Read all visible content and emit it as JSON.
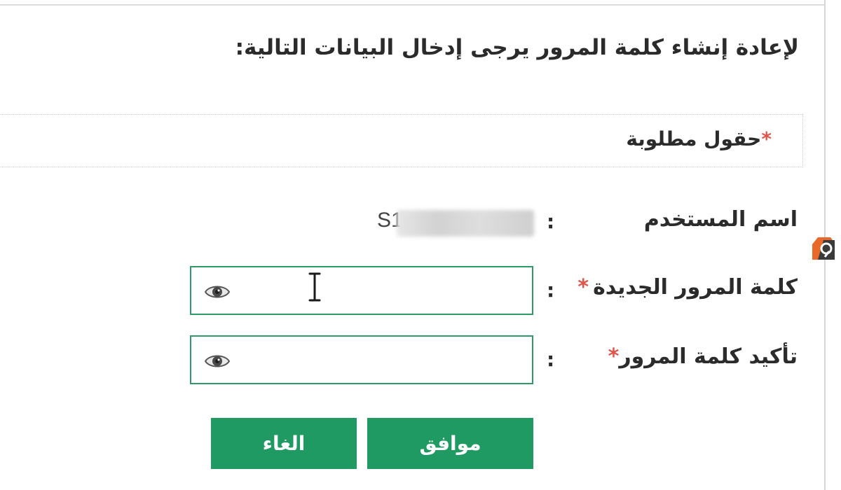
{
  "form": {
    "instructions": "لإعادة إنشاء كلمة المرور يرجى إدخال البيانات التالية:",
    "required_note": "حقول مطلوبة",
    "required_marker": "*",
    "username_label": "اسم المستخدم",
    "username_value": "S1",
    "new_password_label": "كلمة المرور الجديدة",
    "new_password_value": "",
    "confirm_password_label": "تأكيد كلمة المرور",
    "confirm_password_value": "",
    "colon": ":"
  },
  "buttons": {
    "ok_label": "موافق",
    "cancel_label": "الغاء"
  },
  "icons": {
    "show_password": "eye-icon",
    "text_cursor": "text-cursor-icon",
    "watermark": "watermark-logo"
  },
  "colors": {
    "accent": "#1f9a62",
    "input_border": "#2e9a6a",
    "required": "#e0544a"
  }
}
